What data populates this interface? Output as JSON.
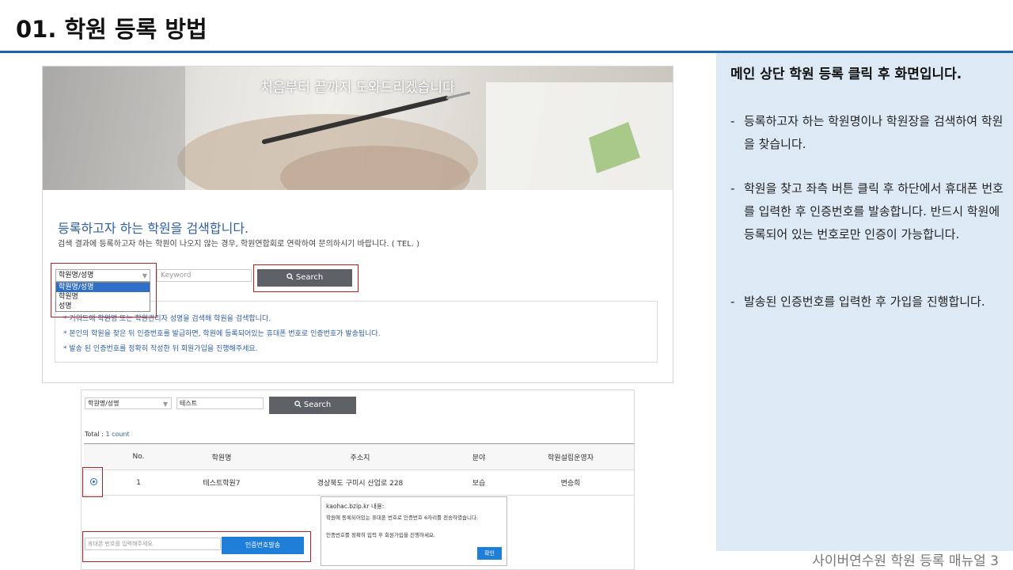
{
  "slide": {
    "title": "01. 학원 등록 방법",
    "footer": "사이버연수원 학원 등록 매뉴얼  3",
    "accent_color": "#1b64b0",
    "panel_color": "#dde9f5"
  },
  "instructions": {
    "heading": "메인 상단 학원 등록 클릭 후 화면입니다.",
    "items": [
      {
        "dash": "-",
        "text": "등록하고자 하는 학원명이나 학원장을 검색하여 학원을 찾습니다."
      },
      {
        "dash": "-",
        "text": "학원을 찾고 좌측 버튼 클릭 후 하단에서 휴대폰 번호를 입력한 후 인증번호를 발송합니다. 반드시 학원에 등록되어 있는 번호로만 인증이 가능합니다."
      },
      {
        "dash": "-",
        "text": "발송된 인증번호를 입력한 후 가입을 진행합니다."
      }
    ]
  },
  "shot1": {
    "banner_text": "처음부터 끝까지 도와드리겠습니다",
    "search_title": "등록하고자 하는 학원을 검색합니다.",
    "search_desc": "검색 결과에 등록하고자 하는 학원이 나오지 않는 경우, 학원연합회로 연락하여 문의하시기 바랍니다. ( TEL. )",
    "select_value": "학원명/성명",
    "select_options": [
      "학원명/성명",
      "학원명",
      "성명"
    ],
    "keyword_placeholder": "Keyword",
    "search_button": "Search",
    "search_icon": "magnifier-icon",
    "info_lines": [
      "* 키워드에 학원명 또는 학원관리자 성명을 검색해 학원을 검색합니다.",
      "* 본인의 학원을 찾은 뒤 인증번호를 발급하면, 학원에 등록되어있는 휴대폰 번호로 인증번호가 발송됩니다.",
      "* 발송 된 인증번호를 정확히 작성한 뒤 회원가입을 진행해주세요."
    ]
  },
  "shot2": {
    "select_value": "학원명/성명",
    "keyword_value": "테스트",
    "search_button": "Search",
    "total_label": "Total : ",
    "total_value": "1 count",
    "columns": [
      "",
      "No.",
      "학원명",
      "주소지",
      "분야",
      "학원설립운영자"
    ],
    "rows": [
      {
        "no": "1",
        "name": "테스트학원7",
        "address": "경상북도 구미시 산업로 228",
        "field": "보습",
        "owner": "변승희"
      }
    ],
    "phone_placeholder": "휴대폰 번호를 입력해주세요.",
    "cert_button": "인증번호발송",
    "alert": {
      "title": "kaohac.bzip.kr 내용:",
      "line1": "학원에 등록되어있는 휴대폰 번호로 인증번호 6자리를 전송하였습니다.",
      "line2": "인증번호를 정확히 입력 후 회원가입을 진행하세요.",
      "ok": "확인"
    }
  }
}
